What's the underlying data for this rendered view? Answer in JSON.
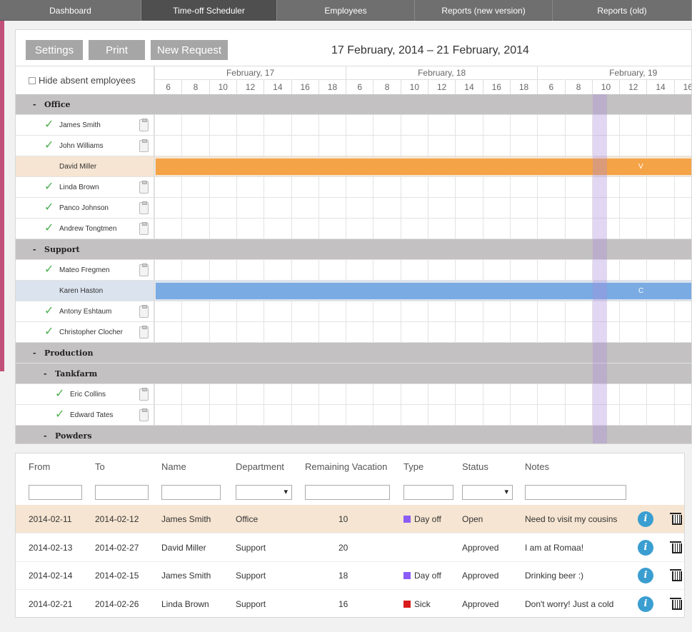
{
  "nav": {
    "items": [
      "Dashboard",
      "Time-off Scheduler",
      "Employees",
      "Reports (new version)",
      "Reports (old)"
    ],
    "active": "Time-off Scheduler"
  },
  "toolbar": {
    "settings_label": "Settings",
    "print_label": "Print",
    "new_request_label": "New Request",
    "date_range": "17 February, 2014 – 21 February, 2014"
  },
  "grid": {
    "hide_absent_label": "Hide absent employees",
    "days": [
      "February, 17",
      "February, 18",
      "February, 19"
    ],
    "hours": [
      "6",
      "8",
      "10",
      "12",
      "14",
      "16",
      "18"
    ],
    "rows": [
      {
        "kind": "group",
        "label": "-   Office"
      },
      {
        "kind": "employee",
        "name": "James Smith",
        "check": true
      },
      {
        "kind": "employee",
        "name": "John Williams",
        "check": true
      },
      {
        "kind": "absent",
        "name": "David Miller",
        "bar_label": "V",
        "color": "#f5a347",
        "bg": "#f6e5d2"
      },
      {
        "kind": "employee",
        "name": "Linda Brown",
        "check": true
      },
      {
        "kind": "employee",
        "name": "Panco Johnson",
        "check": true
      },
      {
        "kind": "employee",
        "name": "Andrew Tongtmen",
        "check": true
      },
      {
        "kind": "group",
        "label": "-   Support"
      },
      {
        "kind": "employee",
        "name": "Mateo Fregmen",
        "check": true
      },
      {
        "kind": "absent",
        "name": "Karen Haston",
        "bar_label": "C",
        "color": "#7aabe3",
        "bg": "#dbe3ee"
      },
      {
        "kind": "employee",
        "name": "Antony Eshtaum",
        "check": true
      },
      {
        "kind": "employee",
        "name": "Christopher Clocher",
        "check": true
      },
      {
        "kind": "group",
        "label": "-   Production"
      },
      {
        "kind": "subgroup",
        "label": "-   Tankfarm"
      },
      {
        "kind": "employee",
        "name": "Eric Collins",
        "check": true,
        "indent": true
      },
      {
        "kind": "employee",
        "name": "Edward Tates",
        "check": true,
        "indent": true
      },
      {
        "kind": "subgroup",
        "label": "-   Powders"
      }
    ]
  },
  "table": {
    "headers": [
      "From",
      "To",
      "Name",
      "Department",
      "Remaining Vacation",
      "Type",
      "Status",
      "Notes"
    ],
    "rows": [
      {
        "from": "2014-02-11",
        "to": "2014-02-12",
        "name": "James Smith",
        "department": "Office",
        "remaining": "10",
        "type": "Day off",
        "type_color": "#8b5cf6",
        "status": "Open",
        "notes": "Need to visit my cousins",
        "highlight": true
      },
      {
        "from": "2014-02-13",
        "to": "2014-02-27",
        "name": "David Miller",
        "department": "Support",
        "remaining": "20",
        "type": "",
        "type_color": "",
        "status": "Approved",
        "notes": "I am at Romaa!",
        "highlight": false
      },
      {
        "from": "2014-02-14",
        "to": "2014-02-15",
        "name": "James Smith",
        "department": "Support",
        "remaining": "18",
        "type": "Day off",
        "type_color": "#8b5cf6",
        "status": "Approved",
        "notes": "Drinking beer :)",
        "highlight": false
      },
      {
        "from": "2014-02-21",
        "to": "2014-02-26",
        "name": "Linda Brown",
        "department": "Support",
        "remaining": "16",
        "type": "Sick",
        "type_color": "#d81b1b",
        "status": "Approved",
        "notes": "Don't worry! Just a cold",
        "highlight": false
      }
    ]
  }
}
